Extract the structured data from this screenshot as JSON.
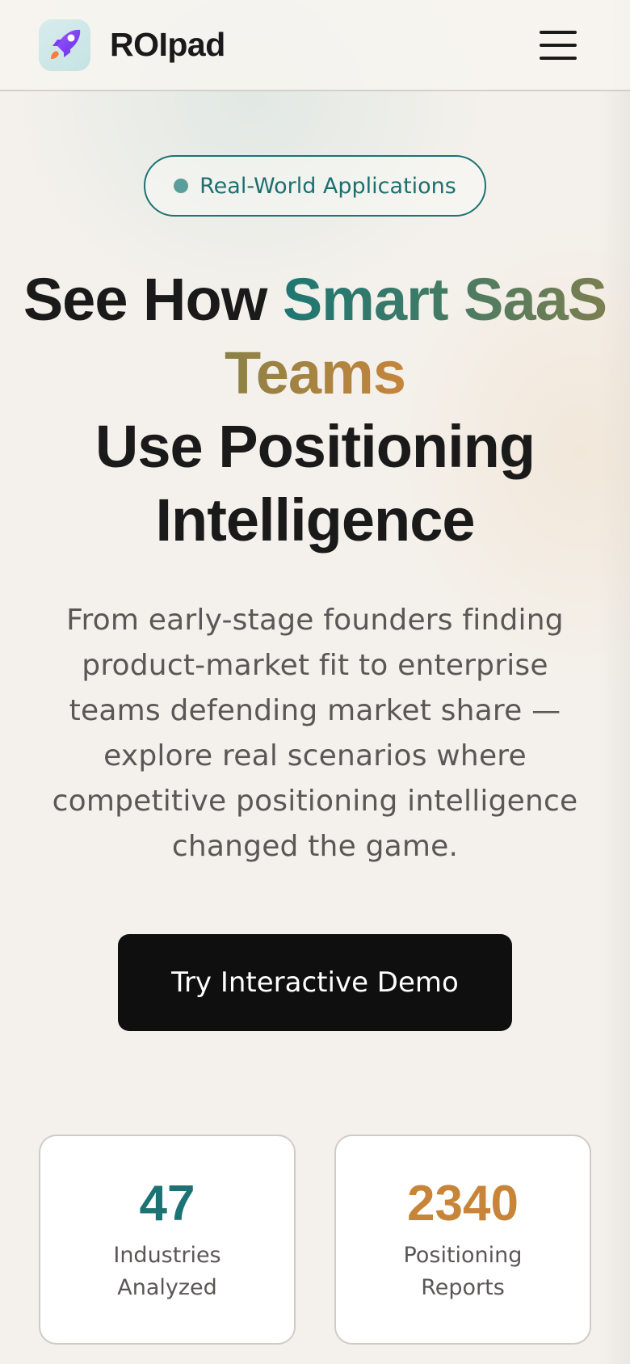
{
  "header": {
    "brand": "ROIpad",
    "logo_icon": "rocket-icon",
    "menu_icon": "hamburger-menu-icon"
  },
  "hero": {
    "badge": "Real-World Applications",
    "title_part1": "See How ",
    "title_highlight_a": "Smart SaaS",
    "title_highlight_b": "Teams",
    "title_line3": "Use Positioning",
    "title_line4": "Intelligence",
    "description": "From early-stage founders finding product-market fit to enterprise teams defending market share — explore real scenarios where competitive positioning intelligence changed the game.",
    "cta_label": "Try Interactive Demo"
  },
  "stats": [
    {
      "value": "47",
      "label": "Industries Analyzed",
      "color": "#1d7273"
    },
    {
      "value": "2340",
      "label": "Positioning Reports",
      "color": "#c8853a"
    }
  ],
  "colors": {
    "accent_teal": "#1d7273",
    "accent_orange": "#c8853a",
    "cta_background": "#0f0f0f",
    "page_background": "#f4f1ec"
  }
}
